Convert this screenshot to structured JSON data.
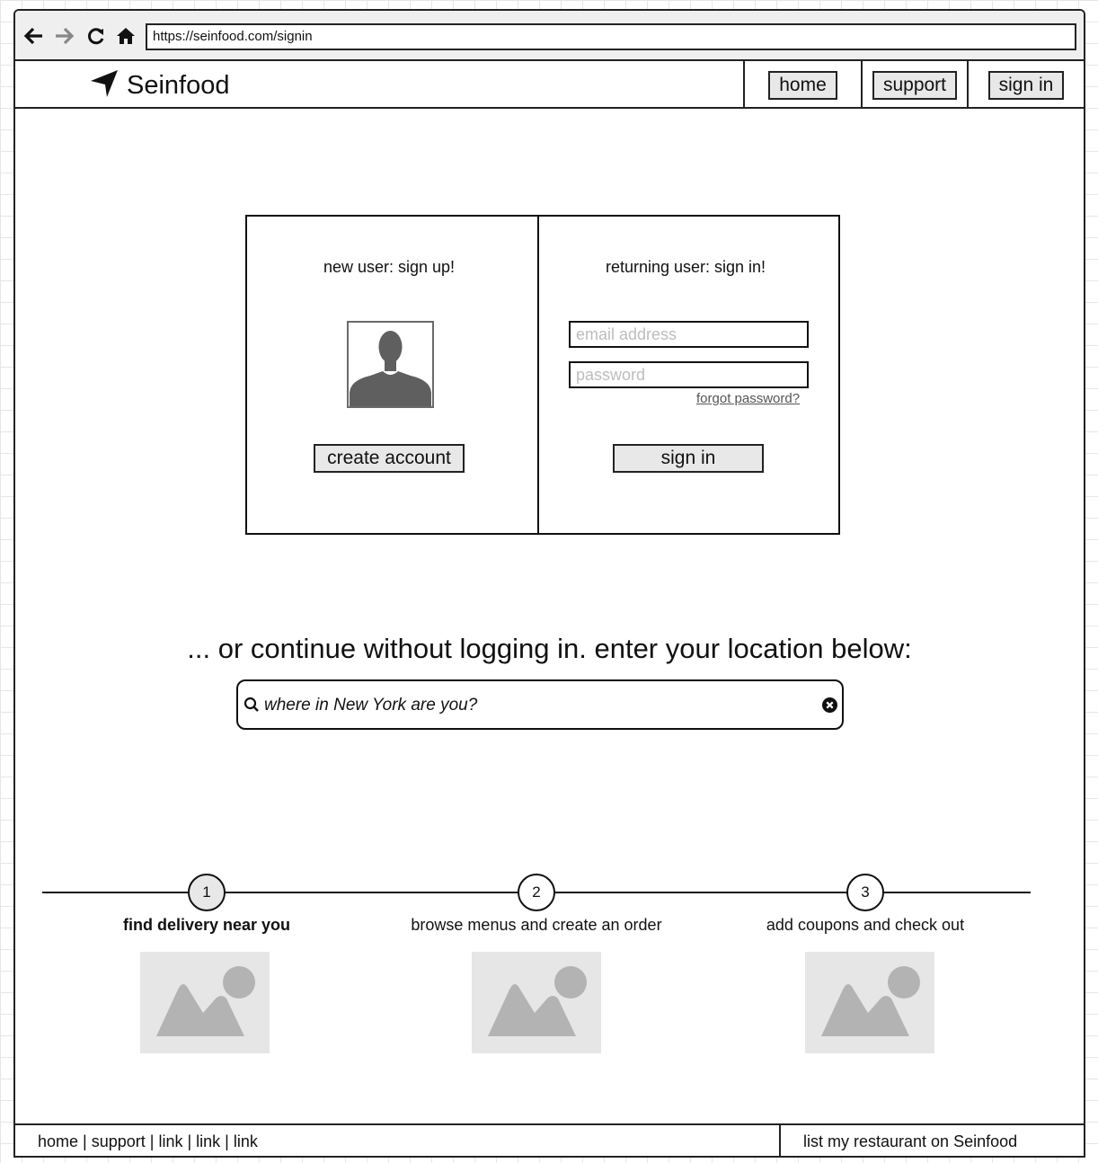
{
  "browser": {
    "url": "https://seinfood.com/signin",
    "icons": [
      "arrow-left-icon",
      "arrow-right-icon",
      "reload-icon",
      "home-icon"
    ]
  },
  "header": {
    "brand": "Seinfood",
    "logo_icon": "location-arrow-icon",
    "nav": [
      {
        "label": "home"
      },
      {
        "label": "support"
      },
      {
        "label": "sign in"
      }
    ]
  },
  "signup": {
    "title": "new user: sign up!",
    "avatar_icon": "user-silhouette-icon",
    "button": "create account"
  },
  "signin": {
    "title": "returning user: sign in!",
    "email_placeholder": "email address",
    "password_placeholder": "password",
    "forgot": "forgot password?",
    "button": "sign in"
  },
  "continue": {
    "heading": "... or continue without logging in. enter your location below:",
    "search_placeholder": "where in New York are you?",
    "search_icon": "search-icon",
    "clear_icon": "clear-icon"
  },
  "steps": [
    {
      "number": "1",
      "label": "find delivery near you",
      "active": true,
      "image_icon": "image-placeholder-icon"
    },
    {
      "number": "2",
      "label": "browse menus and create an order",
      "active": false,
      "image_icon": "image-placeholder-icon"
    },
    {
      "number": "3",
      "label": "add coupons and check out",
      "active": false,
      "image_icon": "image-placeholder-icon"
    }
  ],
  "footer": {
    "links": [
      "home",
      "support",
      "link",
      "link",
      "link"
    ],
    "separator": " | ",
    "right": "list my restaurant on Seinfood"
  },
  "colors": {
    "border": "#222222",
    "button_fill": "#e8e8e8",
    "placeholder_text": "#bdbdbd",
    "image_placeholder": "#e6e6e6",
    "avatar_fill": "#5f5f5f"
  }
}
